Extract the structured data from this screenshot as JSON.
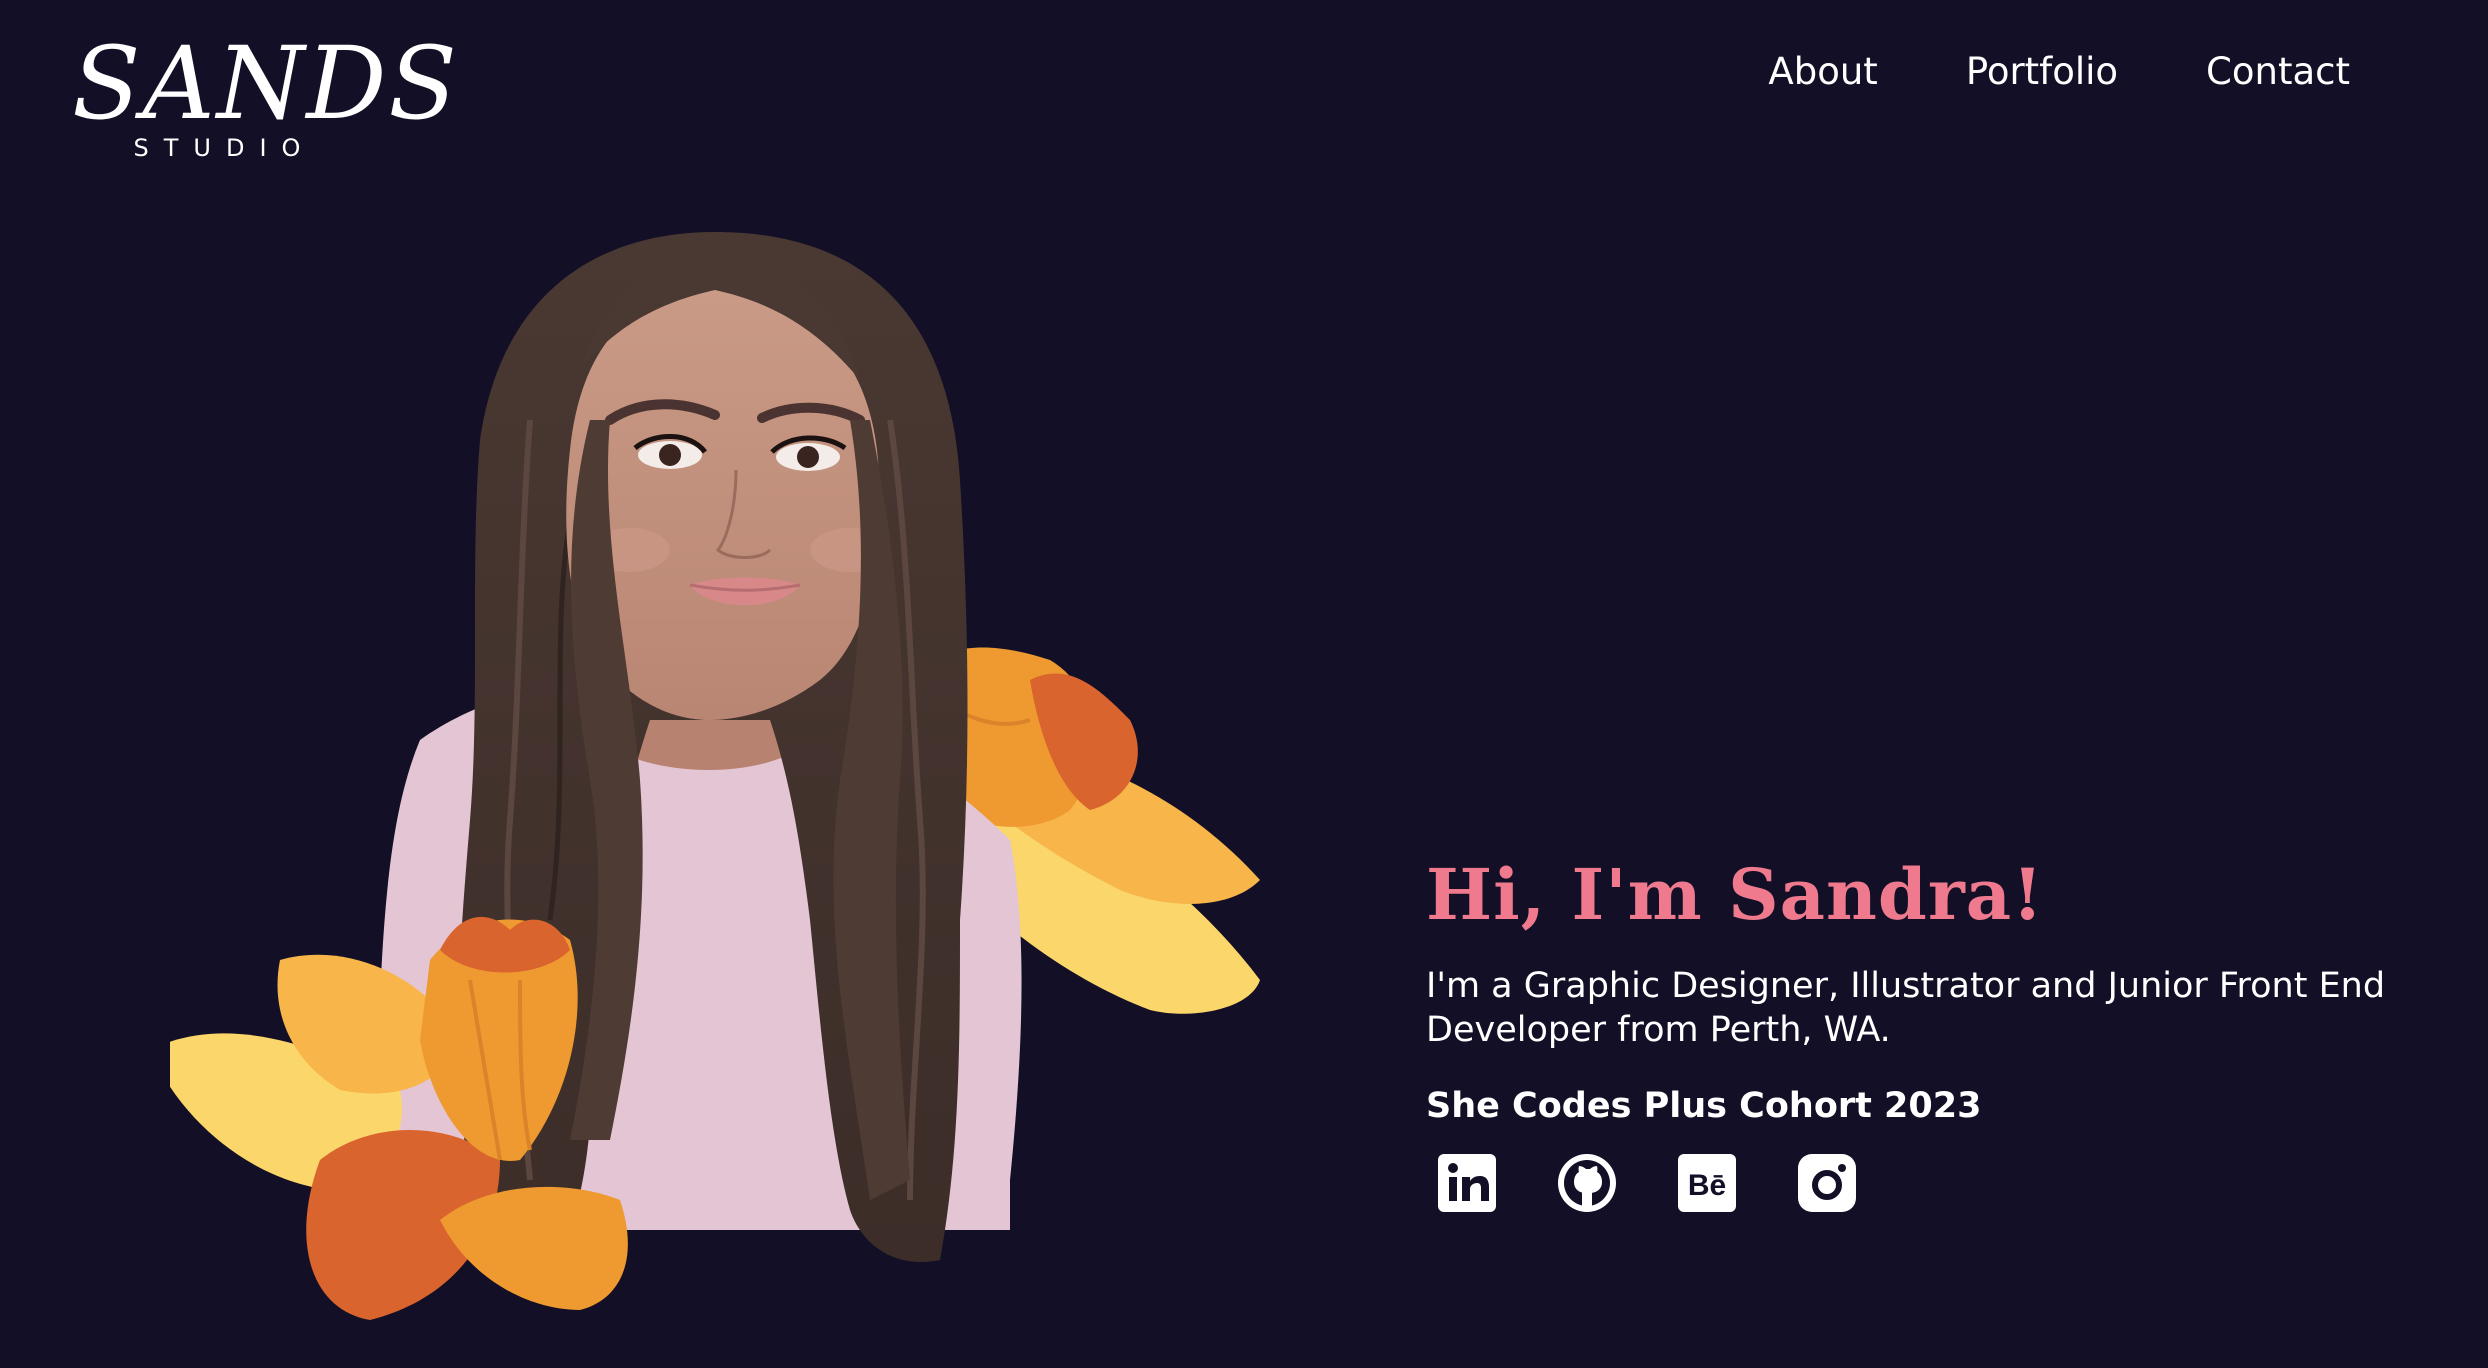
{
  "brand": {
    "name": "SANDS",
    "tagline": "STUDIO"
  },
  "nav": {
    "items": [
      "About",
      "Portfolio",
      "Contact"
    ]
  },
  "hero": {
    "greeting": "Hi, I'm Sandra!",
    "bio": "I'm a Graphic Designer, Illustrator and Junior Front End Developer from Perth, WA.",
    "cohort": "She Codes Plus Cohort 2023"
  },
  "socials": [
    {
      "name": "linkedin-icon"
    },
    {
      "name": "github-icon"
    },
    {
      "name": "behance-icon"
    },
    {
      "name": "instagram-icon"
    }
  ],
  "colors": {
    "background": "#130f26",
    "accent_pink": "#ef7a8e",
    "text": "#ffffff",
    "hair": "#4e3b34",
    "skin": "#c9957f",
    "shirt": "#e4c5d4",
    "flower_orange": "#ef9a30",
    "flower_yellow": "#fbd66a",
    "flower_dark": "#d9642d"
  }
}
